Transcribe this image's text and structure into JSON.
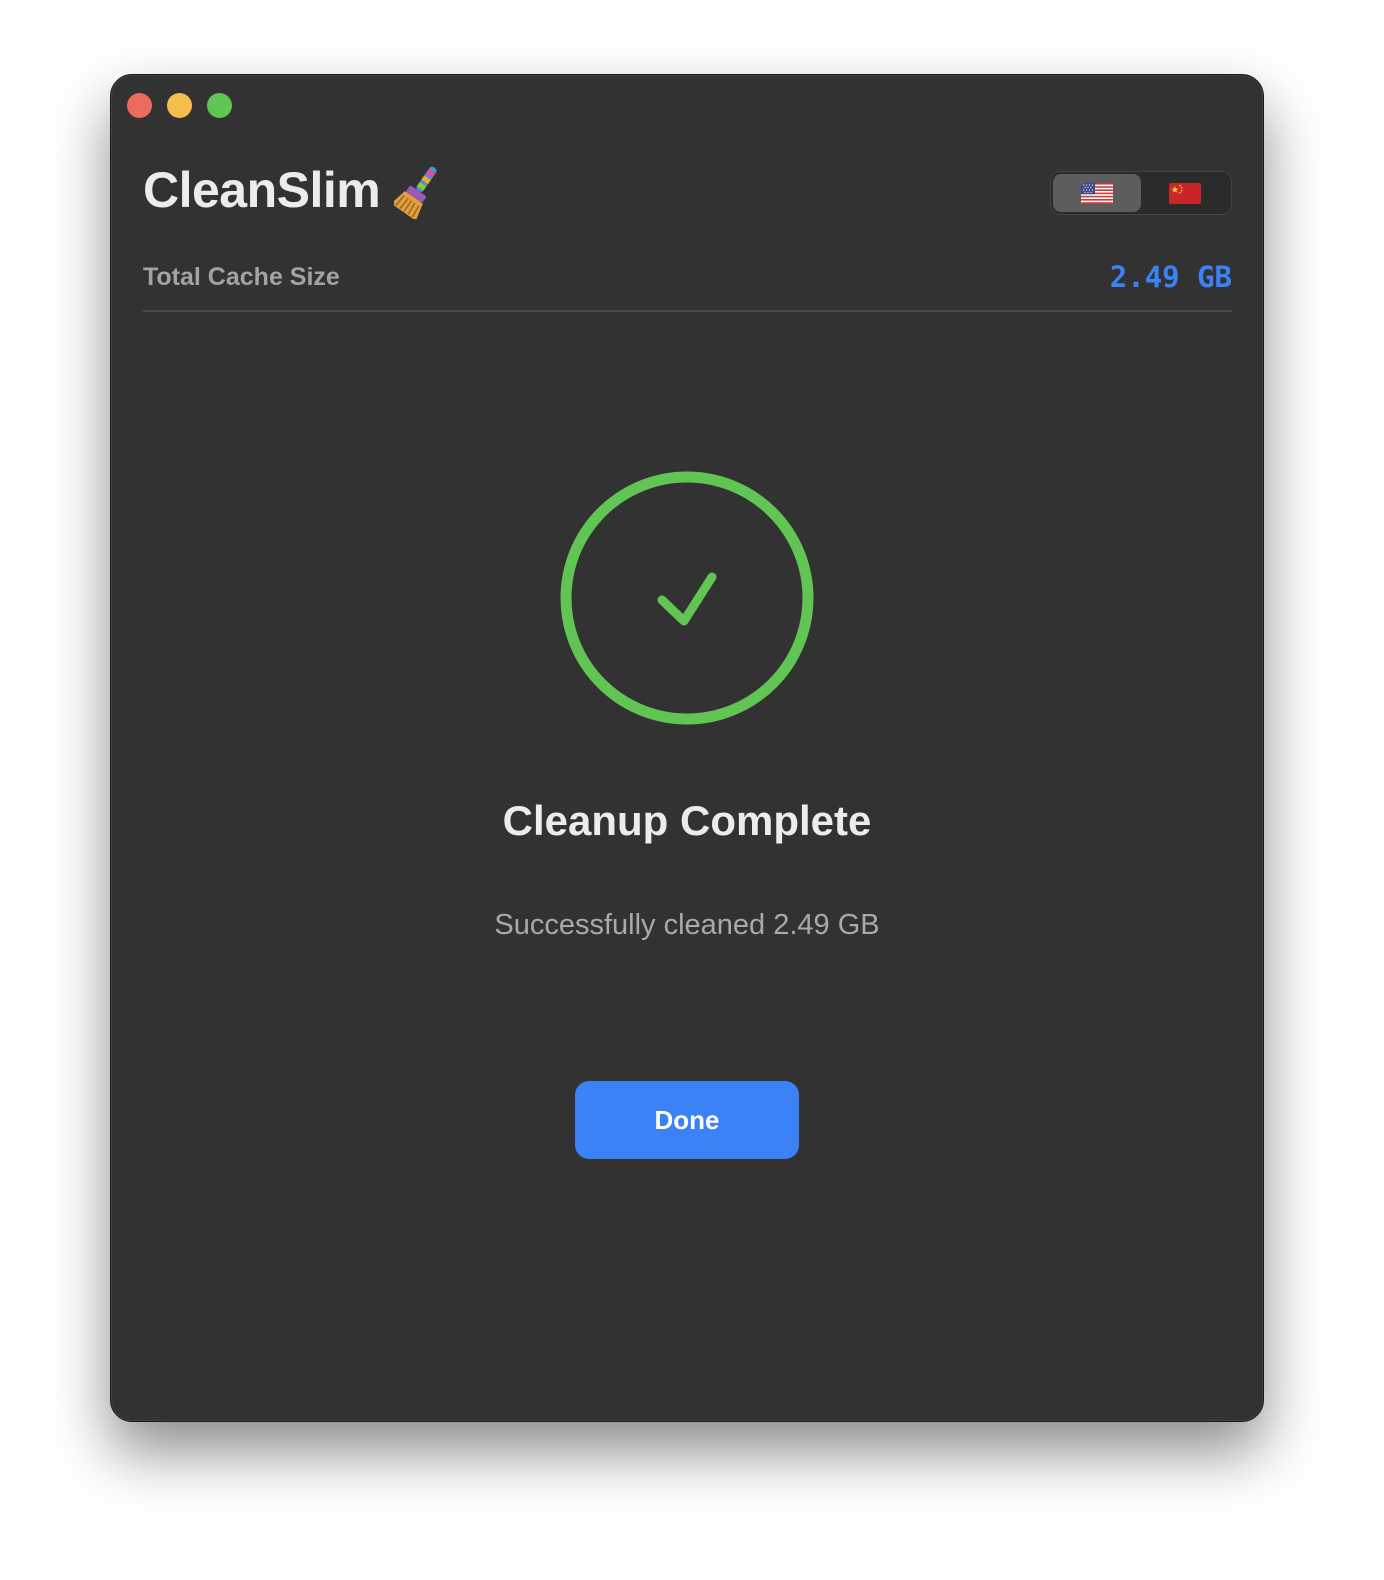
{
  "window": {
    "controls": [
      "close",
      "minimize",
      "zoom"
    ]
  },
  "header": {
    "app_name": "CleanSlim",
    "app_icon": "broom-icon"
  },
  "language_toggle": {
    "options": [
      {
        "code": "en",
        "icon": "us-flag-icon",
        "selected": true
      },
      {
        "code": "zh",
        "icon": "china-flag-icon",
        "selected": false
      }
    ]
  },
  "cache": {
    "label": "Total Cache Size",
    "value": "2.49 GB",
    "value_color": "#3b82f6"
  },
  "result": {
    "status_icon": "checkmark-circle-icon",
    "status_color": "#61c554",
    "title": "Cleanup Complete",
    "message": "Successfully cleaned 2.49 GB"
  },
  "actions": {
    "done_label": "Done",
    "done_color": "#3b82f6"
  }
}
